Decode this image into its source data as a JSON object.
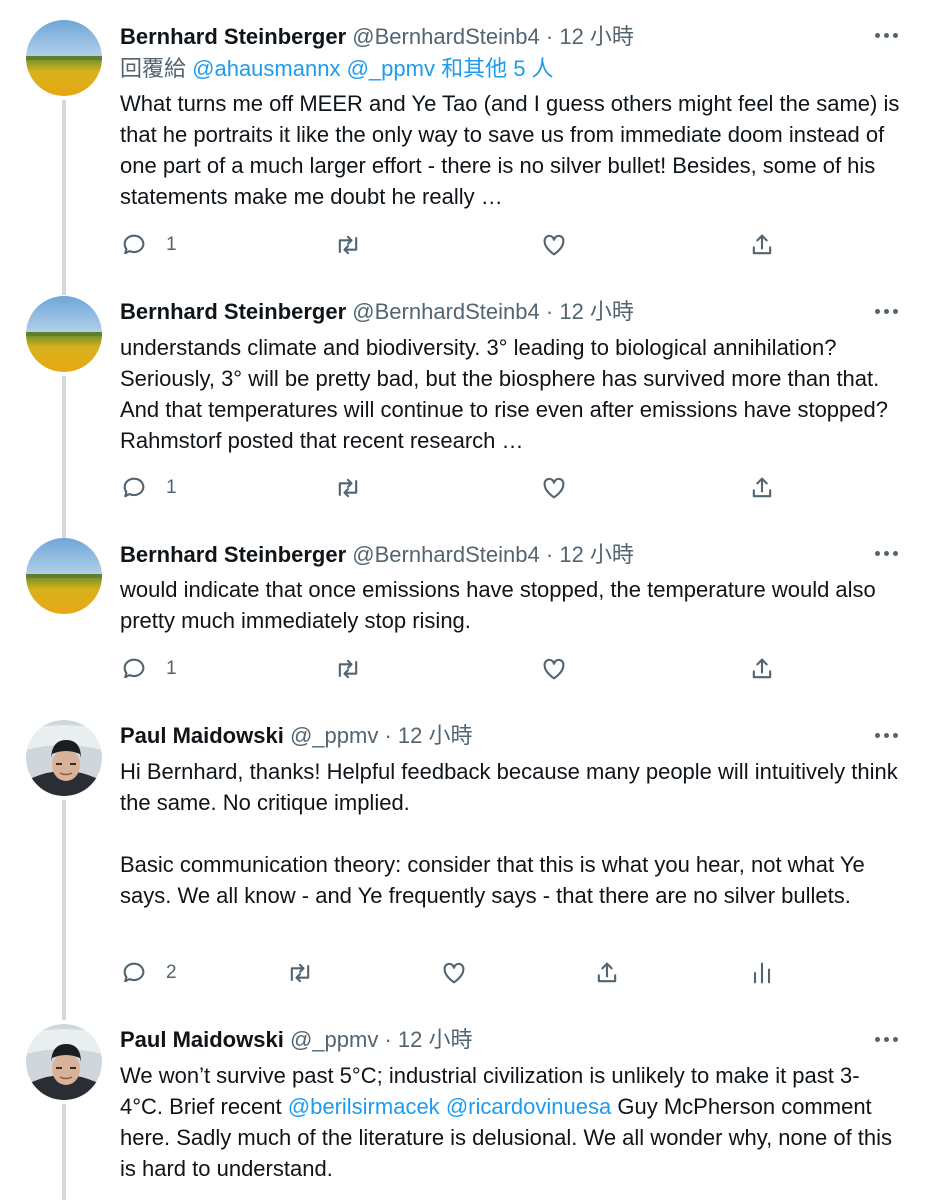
{
  "tweets": [
    {
      "name": "Bernhard Steinberger",
      "handle": "@BernhardSteinb4",
      "time": "12 小時",
      "reply_prefix": "回覆給",
      "reply_mentions": [
        "@ahausmannx",
        "@_ppmv"
      ],
      "reply_suffix": "和其他 5 人",
      "text": "What turns me off MEER and Ye Tao (and I guess others might feel the same) is that he portraits it like the only way to save us from immediate doom instead of one part of a much larger effort - there is no silver bullet! Besides, some of his statements make me doubt he really …",
      "reply_count": "1"
    },
    {
      "name": "Bernhard Steinberger",
      "handle": "@BernhardSteinb4",
      "time": "12 小時",
      "text": "understands climate and biodiversity. 3° leading to biological annihilation? Seriously, 3° will be pretty bad, but the biosphere has survived more than that. And that temperatures will continue to rise even after emissions have stopped? Rahmstorf posted that recent research …",
      "reply_count": "1"
    },
    {
      "name": "Bernhard Steinberger",
      "handle": "@BernhardSteinb4",
      "time": "12 小時",
      "text": "would indicate that once emissions have stopped, the temperature would also pretty much immediately stop rising.",
      "reply_count": "1"
    },
    {
      "name": "Paul Maidowski",
      "handle": "@_ppmv",
      "time": "12 小時",
      "text_p1": "Hi Bernhard, thanks! Helpful feedback because many people will intuitively think the same. No critique implied.",
      "text_p2": "Basic communication theory: consider that this is what you hear, not what Ye says. We all know - and Ye frequently says - that there are no silver bullets.",
      "reply_count": "2"
    },
    {
      "name": "Paul Maidowski",
      "handle": "@_ppmv",
      "time": "12 小時",
      "text_a": "We won’t survive past 5°C; industrial civilization is unlikely to make it past 3-4°C. Brief recent",
      "mention_1": "@berilsirmacek",
      "mention_2": "@ricardovinuesa",
      "text_b": "Guy McPherson comment here. Sadly much of the literature is delusional. We all wonder why, none of this is hard to understand."
    }
  ],
  "separator": "·",
  "colors": {
    "text": "#0f1419",
    "secondary": "#536471",
    "link": "#1d9bf0",
    "thread_line": "#cfd9de"
  }
}
